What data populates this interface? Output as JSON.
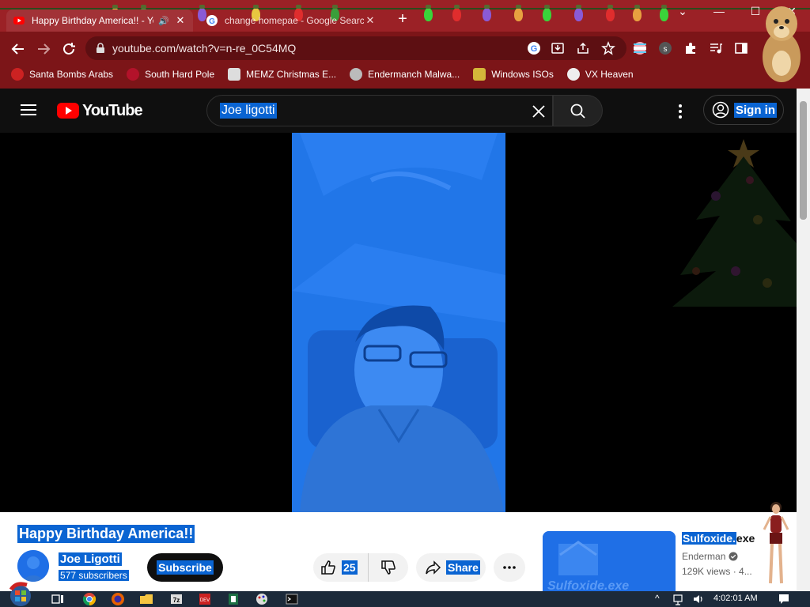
{
  "browser": {
    "tabs": [
      {
        "title": "Happy Birthday America!! - YouTube",
        "active": true,
        "audio": true
      },
      {
        "title": "change homepae - Google Search",
        "active": false
      }
    ],
    "new_tab": "+",
    "url": "youtube.com/watch?v=n-re_0C54MQ",
    "bookmarks": [
      {
        "label": "Santa Bombs Arabs",
        "icon": "santa-icon"
      },
      {
        "label": "South Hard Pole",
        "icon": "snowflake-icon"
      },
      {
        "label": "MEMZ Christmas E...",
        "icon": "memz-icon"
      },
      {
        "label": "Endermanch Malwa...",
        "icon": "enderman-icon"
      },
      {
        "label": "Windows ISOs",
        "icon": "windows-icon"
      },
      {
        "label": "VX Heaven",
        "icon": "vx-icon"
      }
    ],
    "colors": {
      "frame": "#7c1518",
      "tab_active": "#a23237"
    }
  },
  "youtube": {
    "logo_text": "YouTube",
    "search": {
      "value": "Joe ligotti"
    },
    "sign_in": "Sign in",
    "video": {
      "title": "Happy Birthday America!!",
      "channel": "Joe Ligotti",
      "subscribers": "577 subscribers",
      "subscribe_label": "Subscribe",
      "likes": "25",
      "share_label": "Share"
    },
    "recommended": {
      "title_highlight": "Sulfoxide.",
      "title_rest": "exe",
      "channel": "Enderman",
      "meta": "129K views · 4...",
      "thumb_text": "Sulfoxide.exe"
    },
    "colors": {
      "selection": "#0a64d2",
      "video_tint": "#1f6fe6"
    }
  },
  "taskbar": {
    "clock": "4:02:01 AM",
    "apps": [
      "explorer-icon",
      "chrome-icon",
      "firefox-icon",
      "folder-icon",
      "7zip-icon",
      "malware-icon",
      "excel-icon",
      "paint-icon",
      "cmd-icon"
    ]
  }
}
